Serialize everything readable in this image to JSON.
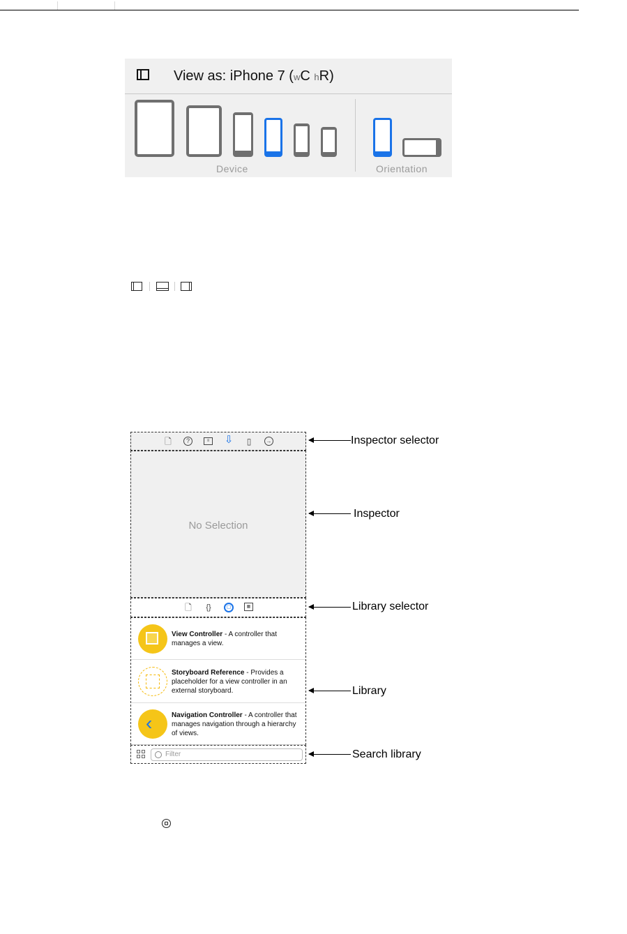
{
  "view_as": {
    "prefix": "View as: ",
    "device": "iPhone 7",
    "size_class_open": " (",
    "w": "w",
    "wc": "C",
    "h": "h",
    "hr": "R",
    "size_class_close": ")",
    "device_group_label": "Device",
    "orientation_group_label": "Orientation",
    "selected_color": "#1a73e8"
  },
  "inspector_selector": {
    "icons": [
      "file-icon",
      "help-icon",
      "identity-icon",
      "attributes-icon",
      "size-icon",
      "connections-icon"
    ]
  },
  "inspector": {
    "empty_text": "No Selection"
  },
  "library_selector": {
    "icons": [
      "file-template-icon",
      "code-snippet-icon",
      "object-library-icon",
      "media-library-icon"
    ]
  },
  "library": {
    "items": [
      {
        "name": "View Controller",
        "desc": " - A controller that manages a view."
      },
      {
        "name": "Storyboard Reference",
        "desc": " - Provides a placeholder for a view controller in an external storyboard."
      },
      {
        "name": "Navigation Controller",
        "desc": " - A controller that manages navigation through a hierarchy of views."
      }
    ],
    "icon_color": "#f5c518"
  },
  "search": {
    "placeholder": "Filter"
  },
  "callouts": {
    "inspector_selector": "Inspector selector",
    "inspector": "Inspector",
    "library_selector": "Library selector",
    "library": "Library",
    "search_library": "Search library"
  }
}
